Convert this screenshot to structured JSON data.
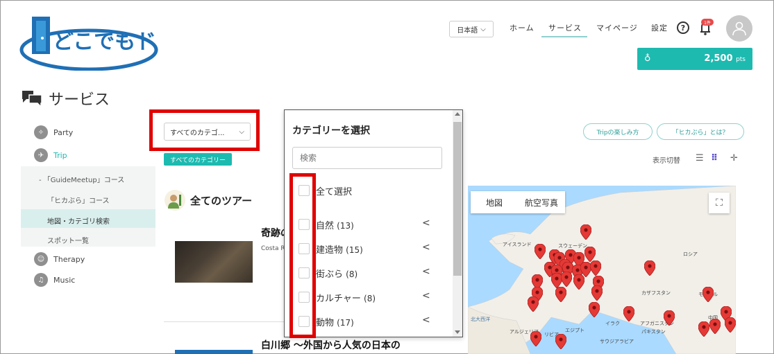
{
  "brand": {
    "logo_text": "どこでもドア"
  },
  "header": {
    "language": "日本語",
    "nav": [
      "ホーム",
      "サービス",
      "マイページ",
      "設定"
    ],
    "notification_badge": "1件",
    "points_value": "2,500",
    "points_unit": "pts"
  },
  "page": {
    "title": "サービス"
  },
  "sidebar": {
    "items": [
      {
        "label": "Party",
        "icon": "party-icon"
      },
      {
        "label": "Trip",
        "icon": "trip-icon"
      },
      {
        "label": "Therapy",
        "icon": "therapy-icon"
      },
      {
        "label": "Music",
        "icon": "music-icon"
      }
    ],
    "trip_sub": [
      "「GuideMeetup」コース",
      "「ヒカぶら」コース",
      "地図・カテゴリ検索",
      "スポット一覧"
    ]
  },
  "filters": {
    "category_select": "すべてのカテゴ...",
    "category_chip": "すべてのカテゴリー"
  },
  "tours": {
    "heading": "全てのツアー",
    "items": [
      {
        "title": "奇跡の",
        "subtitle": "Costa R"
      },
      {
        "title": "白川郷 ～外国から人気の日本の"
      }
    ]
  },
  "category_panel": {
    "title": "カテゴリーを選択",
    "search_placeholder": "検索",
    "select_all": "全て選択",
    "options": [
      {
        "name": "自然",
        "count": "(13)"
      },
      {
        "name": "建造物",
        "count": "(15)"
      },
      {
        "name": "街ぶら",
        "count": "(8)"
      },
      {
        "name": "カルチャー",
        "count": "(8)"
      },
      {
        "name": "動物",
        "count": "(17)"
      }
    ]
  },
  "right_controls": {
    "pill_1": "Tripの楽しみ方",
    "pill_2": "「ヒカぶら」とは？",
    "view_label": "表示切替"
  },
  "map": {
    "tab_map": "地図",
    "tab_satellite": "航空写真",
    "labels": [
      "アイスランド",
      "スウェーデン",
      "ロシア",
      "カザフスタン",
      "モンゴル",
      "北大西洋",
      "イラク",
      "アフガニスタン",
      "パキスタン",
      "中国",
      "アルジェリア",
      "リビア",
      "エジプト",
      "サウジアラビア"
    ]
  },
  "colors": {
    "accent": "#1dbab0",
    "highlight": "#e00000",
    "logo_blue": "#1f6fb5",
    "map_water": "#aadaff",
    "map_land": "#f2efe9",
    "marker": "#e53935"
  }
}
